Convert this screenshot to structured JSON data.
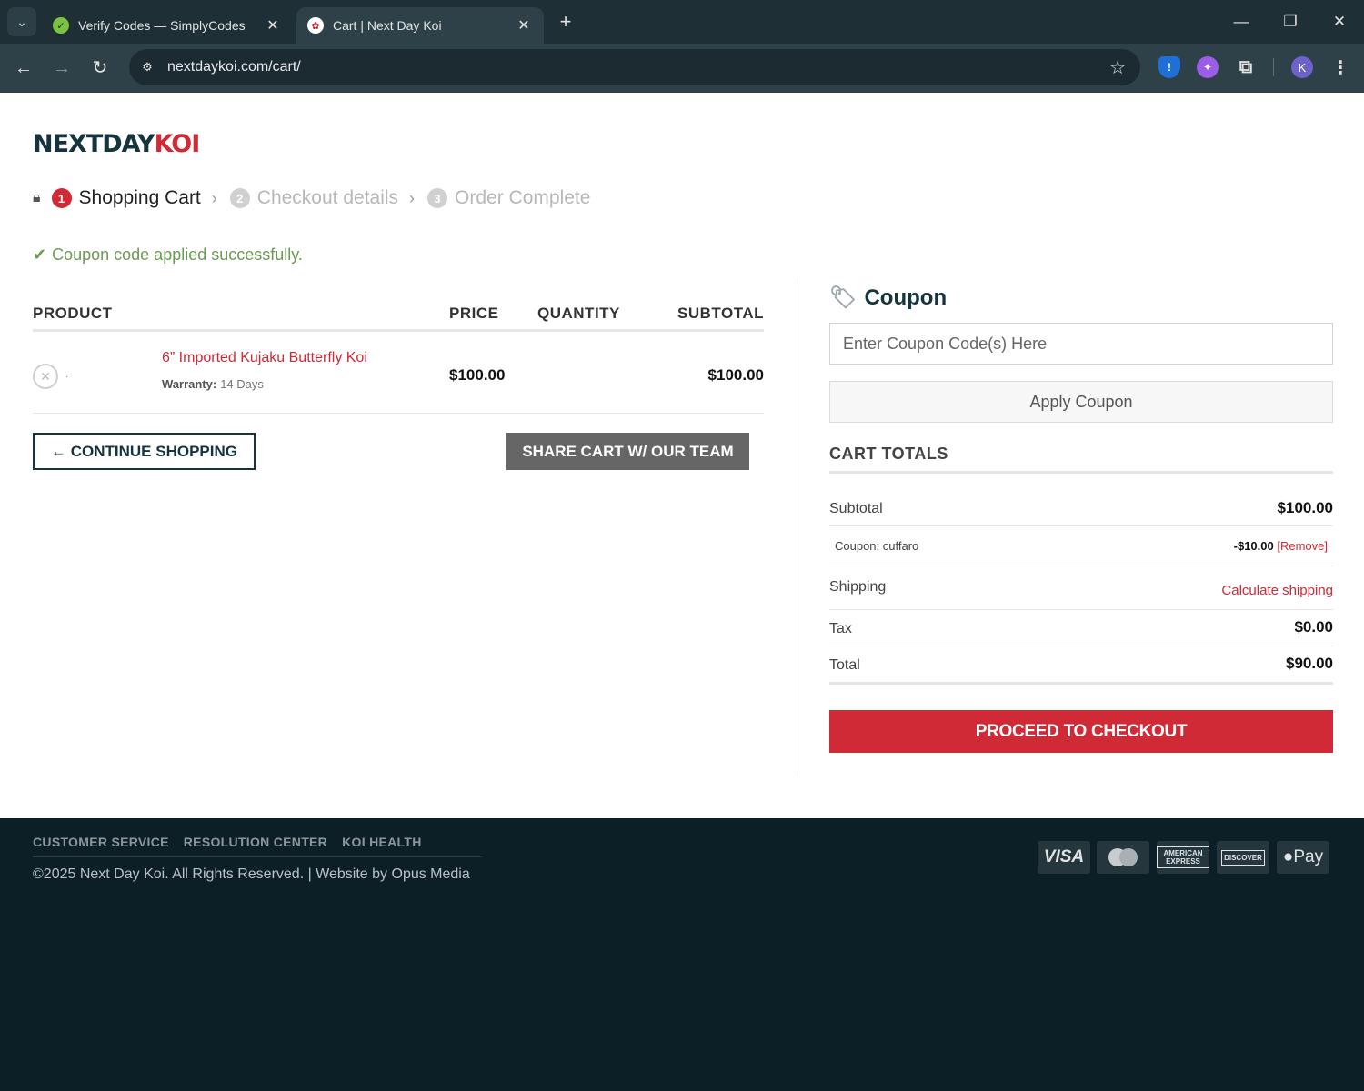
{
  "browser": {
    "tabs": [
      {
        "title": "Verify Codes — SimplyCodes",
        "favicon": "simplycodes-icon",
        "active": false
      },
      {
        "title": "Cart | Next Day Koi",
        "favicon": "nextdaykoi-icon",
        "active": true
      }
    ],
    "url": "nextdaykoi.com/cart/",
    "profile_initial": "K"
  },
  "brand": {
    "part1": "NEXTDAY",
    "part2": "KOI",
    "color_dark": "#15343e",
    "color_red": "#d02a36"
  },
  "steps": [
    {
      "num": "1",
      "label": "Shopping Cart",
      "active": true
    },
    {
      "num": "2",
      "label": "Checkout details",
      "active": false
    },
    {
      "num": "3",
      "label": "Order Complete",
      "active": false
    }
  ],
  "notice": "Coupon code applied successfully.",
  "cart": {
    "headers": {
      "product": "PRODUCT",
      "price": "PRICE",
      "quantity": "QUANTITY",
      "subtotal": "SUBTOTAL"
    },
    "items": [
      {
        "name": "6” Imported Kujaku Butterfly Koi",
        "meta_label": "Warranty:",
        "meta_value": "14 Days",
        "price": "$100.00",
        "subtotal": "$100.00"
      }
    ],
    "continue_label": "← CONTINUE SHOPPING",
    "share_label": "SHARE CART W/ OUR TEAM"
  },
  "coupon": {
    "title": "Coupon",
    "placeholder": "Enter Coupon Code(s) Here",
    "apply_label": "Apply Coupon"
  },
  "totals": {
    "heading": "CART TOTALS",
    "subtotal_label": "Subtotal",
    "subtotal_value": "$100.00",
    "coupon_label": "Coupon: cuffaro",
    "coupon_value": "-$10.00",
    "coupon_remove": "[Remove]",
    "shipping_label": "Shipping",
    "shipping_value": "Calculate shipping",
    "tax_label": "Tax",
    "tax_value": "$0.00",
    "total_label": "Total",
    "total_value": "$90.00",
    "checkout_label": "PROCEED TO CHECKOUT"
  },
  "footer": {
    "links": [
      "CUSTOMER SERVICE",
      "RESOLUTION CENTER",
      "KOI HEALTH"
    ],
    "copyright": "©2025 Next Day Koi. All Rights Reserved. | Website by Opus Media",
    "payments": {
      "visa": "VISA",
      "amex": "AMERICAN EXPRESS",
      "discover": "DISCOVER",
      "apple": " Pay"
    }
  }
}
